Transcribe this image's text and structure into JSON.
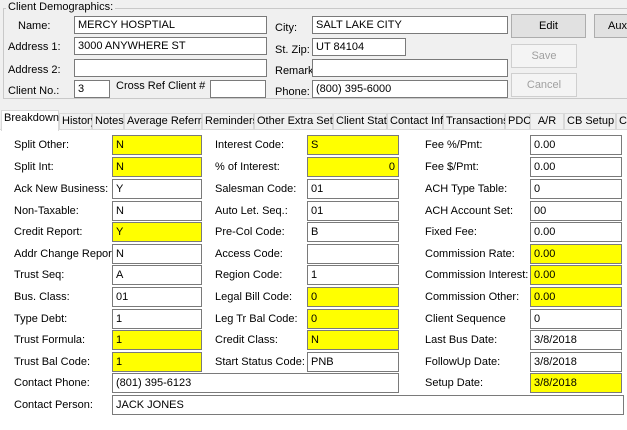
{
  "demographics": {
    "group_title": "Client Demographics:",
    "name_label": "Name:",
    "name_value": "MERCY HOSPTIAL",
    "address1_label": "Address 1:",
    "address1_value": "3000 ANYWHERE ST",
    "address2_label": "Address 2:",
    "address2_value": "",
    "client_no_label": "Client No.:",
    "client_no_value": "3",
    "cross_ref_label": "Cross Ref Client #",
    "cross_ref_value": "",
    "city_label": "City:",
    "city_value": "SALT LAKE CITY",
    "stzip_label": "St. Zip:",
    "stzip_value": "UT 84104",
    "remark_label": "Remark:",
    "remark_value": "",
    "phone_label": "Phone:",
    "phone_value": "(800) 395-6000"
  },
  "buttons": {
    "edit": "Edit",
    "aux": "Aux",
    "save": "Save",
    "cancel": "Cancel"
  },
  "tabs": [
    "Breakdown",
    "History",
    "Notes",
    "Average Referral",
    "Reminders",
    "Other Extra Setup",
    "Client Stats",
    "Contact Info",
    "Transactions",
    "PDC",
    "A/R",
    "CB Setup",
    "Cl"
  ],
  "col1": [
    {
      "label": "Split Other:",
      "value": "N"
    },
    {
      "label": "Split Int:",
      "value": "N"
    },
    {
      "label": "Ack New Business:",
      "value": "Y"
    },
    {
      "label": "Non-Taxable:",
      "value": "N"
    },
    {
      "label": "Credit Report:",
      "value": "Y"
    },
    {
      "label": "Addr Change Report:",
      "value": "N"
    },
    {
      "label": "Trust Seq:",
      "value": "A"
    },
    {
      "label": "Bus. Class:",
      "value": "01"
    },
    {
      "label": "Type Debt:",
      "value": "1"
    },
    {
      "label": "Trust Formula:",
      "value": "1"
    },
    {
      "label": "Trust Bal Code:",
      "value": "1"
    }
  ],
  "col2": [
    {
      "label": "Interest Code:",
      "value": "S"
    },
    {
      "label": "% of Interest:",
      "value": "0"
    },
    {
      "label": "Salesman Code:",
      "value": "01"
    },
    {
      "label": "Auto Let. Seq.:",
      "value": "01"
    },
    {
      "label": "Pre-Col Code:",
      "value": "B"
    },
    {
      "label": "Access Code:",
      "value": ""
    },
    {
      "label": "Region Code:",
      "value": "1"
    },
    {
      "label": "Legal Bill Code:",
      "value": "0"
    },
    {
      "label": "Leg Tr Bal Code:",
      "value": "0"
    },
    {
      "label": "Credit Class:",
      "value": "N"
    },
    {
      "label": "Start Status Code:",
      "value": "PNB"
    }
  ],
  "col3": [
    {
      "label": "Fee %/Pmt:",
      "value": "0.00"
    },
    {
      "label": "Fee $/Pmt:",
      "value": "0.00"
    },
    {
      "label": "ACH Type Table:",
      "value": "0"
    },
    {
      "label": "ACH Account Set:",
      "value": "00"
    },
    {
      "label": "Fixed Fee:",
      "value": "0.00"
    },
    {
      "label": "Commission Rate:",
      "value": "0.00"
    },
    {
      "label": "Commission Interest:",
      "value": "0.00"
    },
    {
      "label": "Commission Other:",
      "value": "0.00"
    },
    {
      "label": "Client Sequence",
      "value": "0"
    },
    {
      "label": "Last Bus Date:",
      "value": "3/8/2018"
    },
    {
      "label": "FollowUp Date:",
      "value": "3/8/2018"
    },
    {
      "label": "Setup Date:",
      "value": "3/8/2018"
    }
  ],
  "contact": {
    "phone_label": "Contact Phone:",
    "phone_value": "(801) 395-6123",
    "person_label": "Contact Person:",
    "person_value": "JACK JONES"
  },
  "colors": {
    "highlight": "#ffff00",
    "window_bg": "#f0f0f0",
    "field_border": "#7a7a7a"
  }
}
